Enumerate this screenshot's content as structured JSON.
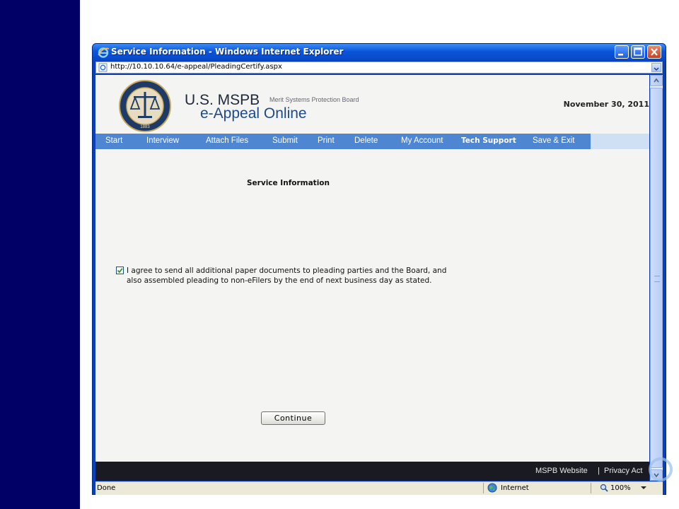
{
  "window": {
    "title": "Service Information - Windows Internet Explorer",
    "address": "http://10.10.10.64/e-appeal/PleadingCertify.aspx"
  },
  "site": {
    "brand_main": "U.S. MSPB",
    "brand_sub": "Merit Systems Protection Board",
    "brand_product": "e-Appeal Online",
    "date": "November 30, 2011",
    "seal_year": "1883"
  },
  "nav": {
    "items": [
      {
        "label": "Start"
      },
      {
        "label": "Interview"
      },
      {
        "label": "Attach Files"
      },
      {
        "label": "Submit"
      },
      {
        "label": "Print"
      },
      {
        "label": "Delete"
      },
      {
        "label": "My Account"
      },
      {
        "label": "Tech Support"
      },
      {
        "label": "Save & Exit"
      }
    ]
  },
  "form": {
    "title": "Service Information",
    "agreement_line1": "I agree to send all additional paper documents to pleading parties and the Board, and",
    "agreement_line2": "also assembled pleading to non-eFilers by the end of next business day as stated.",
    "agreement_checked": true,
    "continue_label": "Continue"
  },
  "footer": {
    "website_link": "MSPB Website",
    "separator": "|",
    "privacy_link": "Privacy Act"
  },
  "statusbar": {
    "status": "Done",
    "zone": "Internet",
    "zoom": "100%"
  },
  "colors": {
    "left_band": "#000066",
    "nav_bar": "#4e86d2",
    "footer": "#1a1a22",
    "titlebar": "#0a55dc"
  }
}
